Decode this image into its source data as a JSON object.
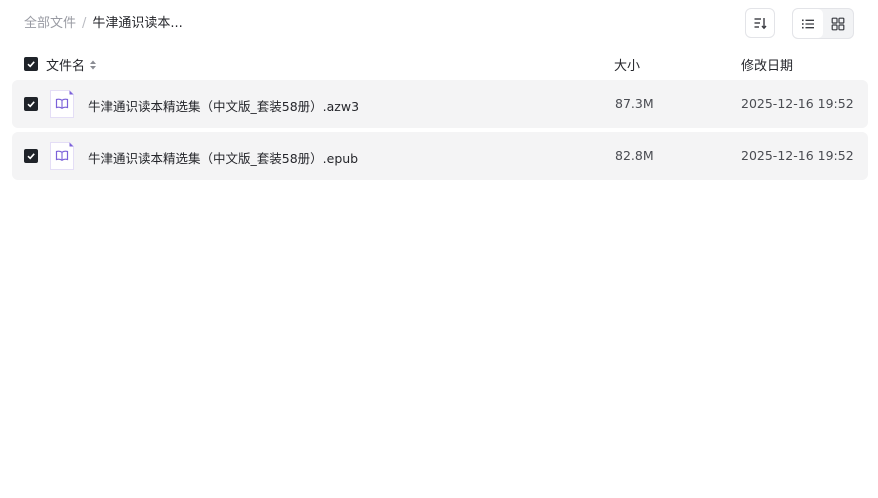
{
  "breadcrumb": {
    "root": "全部文件",
    "separator": "/",
    "current": "牛津通识读本..."
  },
  "toolbar": {
    "sort_icon": "sort-descending-icon",
    "view_list_icon": "list-view-icon",
    "view_grid_icon": "grid-view-icon"
  },
  "table": {
    "headers": {
      "name": "文件名",
      "size": "大小",
      "modified": "修改日期"
    },
    "rows": [
      {
        "name": "牛津通识读本精选集（中文版_套装58册）.azw3",
        "size": "87.3M",
        "modified": "2025-12-16 19:52",
        "icon": "ebook-file-icon",
        "checked": true
      },
      {
        "name": "牛津通识读本精选集（中文版_套装58册）.epub",
        "size": "82.8M",
        "modified": "2025-12-16 19:52",
        "icon": "ebook-file-icon",
        "checked": true
      }
    ]
  },
  "colors": {
    "accent": "#7b61d9",
    "row_bg": "#f4f4f5",
    "checkbox": "#1f2329"
  }
}
